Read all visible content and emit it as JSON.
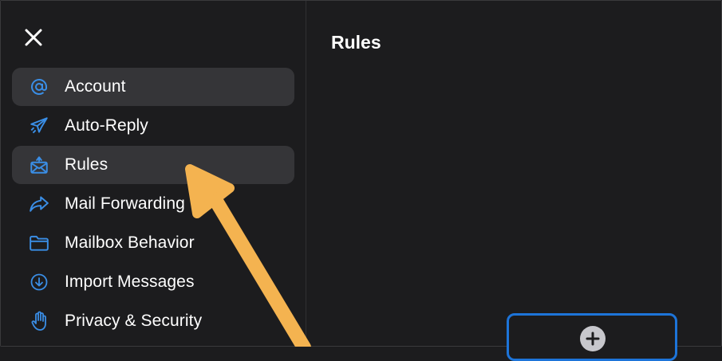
{
  "sidebar": {
    "close_icon": "close-icon",
    "items": [
      {
        "label": "Account",
        "icon": "at-sign-icon",
        "selected": true
      },
      {
        "label": "Auto-Reply",
        "icon": "airplane-icon",
        "selected": false
      },
      {
        "label": "Rules",
        "icon": "envelope-rules-icon",
        "selected": true
      },
      {
        "label": "Mail Forwarding",
        "icon": "forward-arrow-icon",
        "selected": false
      },
      {
        "label": "Mailbox Behavior",
        "icon": "folder-icon",
        "selected": false
      },
      {
        "label": "Import Messages",
        "icon": "download-circle-icon",
        "selected": false
      },
      {
        "label": "Privacy & Security",
        "icon": "hand-icon",
        "selected": false
      }
    ]
  },
  "main": {
    "title": "Rules",
    "add_button_icon": "plus-icon"
  },
  "colors": {
    "background": "#1c1c1e",
    "selected_row": "#353538",
    "accent": "#1d74d9",
    "icon_blue": "#3a8ee6",
    "annotation_arrow": "#f4b350"
  }
}
